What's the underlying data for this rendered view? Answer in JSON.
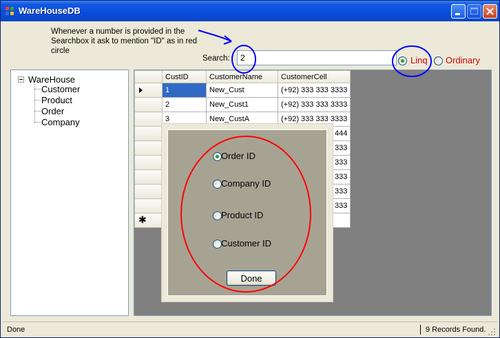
{
  "window": {
    "title": "WareHouseDB"
  },
  "annotation": {
    "note": "Whenever a number is provided in the Searchbox it ask to mention \"ID\" as in red circle"
  },
  "search": {
    "label": "Search:",
    "value": "2"
  },
  "mode": {
    "linq": "Linq",
    "ordinary": "Ordinary",
    "selected": "Linq"
  },
  "tree": {
    "root": "WareHouse",
    "children": [
      "Customer",
      "Product",
      "Order",
      "Company"
    ]
  },
  "grid": {
    "columns": [
      "CustID",
      "CustomerName",
      "CustomerCell"
    ],
    "rows": [
      [
        "1",
        "New_Cust",
        "(+92) 333 333 3333"
      ],
      [
        "2",
        "New_Cust1",
        "(+92) 333 333 3333"
      ],
      [
        "3",
        "New_CustA",
        "(+92) 333 333 3333"
      ],
      [
        "",
        "",
        "444"
      ],
      [
        "",
        "",
        "333"
      ],
      [
        "",
        "",
        "333"
      ],
      [
        "",
        "",
        "333"
      ],
      [
        "",
        "",
        "333"
      ],
      [
        "",
        "",
        "333"
      ]
    ]
  },
  "dialog": {
    "options": [
      "Order ID",
      "Company ID",
      "Product ID",
      "Customer ID"
    ],
    "selected": "Order ID",
    "done_label": "Done"
  },
  "status": {
    "left": "Done",
    "right": "9 Records Found."
  },
  "colors": {
    "annotation_blue": "#0000ff",
    "annotation_red": "#ff0000",
    "radio_label_red": "#cc0000"
  }
}
